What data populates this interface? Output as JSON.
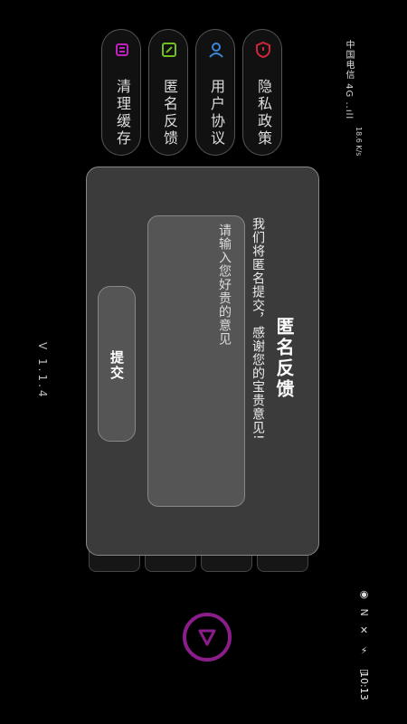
{
  "status_bar": {
    "carrier": "中国电信 4G ..ıll",
    "speed": "18.6 K/s",
    "icons": "◉ N ✕ ⚡ ▭",
    "time": "10:13"
  },
  "menu": [
    {
      "label": "清理缓存",
      "icon": "broom-icon",
      "color": "#c020c0"
    },
    {
      "label": "匿名反馈",
      "icon": "edit-icon",
      "color": "#70c020"
    },
    {
      "label": "用户协议",
      "icon": "user-icon",
      "color": "#3a86d8"
    },
    {
      "label": "隐私政策",
      "icon": "shield-icon",
      "color": "#d0253a"
    }
  ],
  "dialog": {
    "title": "匿名反馈",
    "description": "我们将匿名提交，感谢您的宝贵意见!",
    "placeholder": "请输入您好贵的意见",
    "submit_label": "提交"
  },
  "version": "V 1.1.4",
  "colors": {
    "accent": "#8a1d8a",
    "card_bg": "#3b3b3b",
    "field_bg": "#555555"
  }
}
